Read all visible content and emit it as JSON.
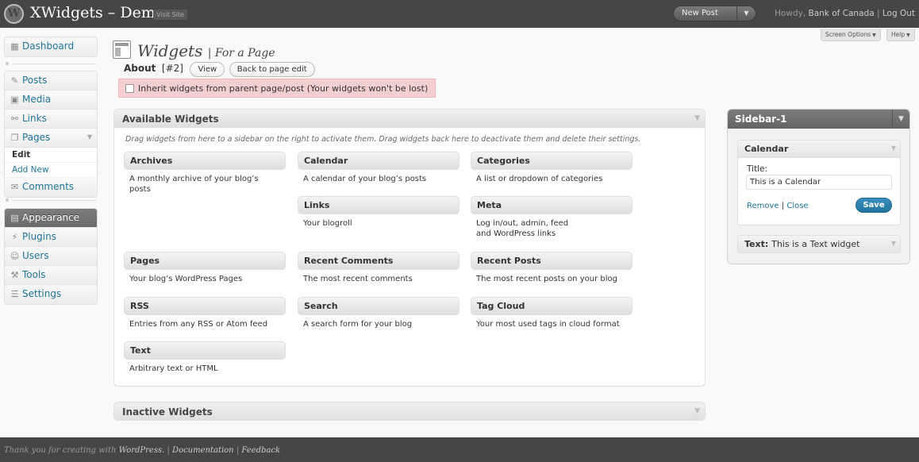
{
  "header": {
    "site_title": "XWidgets – Demo",
    "visit_site": "Visit Site",
    "favorite_action": "New Post",
    "howdy": "Howdy,",
    "user_name": "Bank of Canada",
    "separator": "|",
    "logout": "Log Out"
  },
  "screen_meta": {
    "screen_options": "Screen Options",
    "help": "Help"
  },
  "menu": {
    "dashboard": "Dashboard",
    "posts": "Posts",
    "media": "Media",
    "links": "Links",
    "pages": "Pages",
    "pages_sub": [
      "Edit",
      "Add New"
    ],
    "comments": "Comments",
    "appearance": "Appearance",
    "plugins": "Plugins",
    "users": "Users",
    "tools": "Tools",
    "settings": "Settings"
  },
  "page": {
    "title": "Widgets",
    "subtitle": "| For a Page",
    "about_label": "About",
    "about_id": "[#2]",
    "view_button": "View",
    "back_button": "Back to page edit",
    "inherit_label": "Inherit widgets from parent page/post (Your widgets won't be lost)",
    "inherit_checked": false
  },
  "available": {
    "title": "Available Widgets",
    "description": "Drag widgets from here to a sidebar on the right to activate them. Drag widgets back here to deactivate them and delete their settings.",
    "widgets": [
      {
        "title": "Archives",
        "desc": "A monthly archive of your blog’s posts"
      },
      {
        "title": "Calendar",
        "desc": "A calendar of your blog’s posts"
      },
      {
        "title": "Categories",
        "desc": "A list or dropdown of categories"
      },
      {
        "title": "Links",
        "desc": "Your blogroll"
      },
      {
        "title": "Meta",
        "desc": "Log in/out, admin, feed and WordPress links"
      },
      {
        "title": "Pages",
        "desc": "Your blog’s WordPress Pages"
      },
      {
        "title": "Recent Comments",
        "desc": "The most recent comments"
      },
      {
        "title": "Recent Posts",
        "desc": "The most recent posts on your blog"
      },
      {
        "title": "RSS",
        "desc": "Entries from any RSS or Atom feed"
      },
      {
        "title": "Search",
        "desc": "A search form for your blog"
      },
      {
        "title": "Tag Cloud",
        "desc": "Your most used tags in cloud format"
      },
      {
        "title": "Text",
        "desc": "Arbitrary text or HTML"
      }
    ]
  },
  "inactive": {
    "title": "Inactive Widgets"
  },
  "sidebar": {
    "title": "Sidebar-1",
    "calendar_widget": {
      "title": "Calendar",
      "field_label": "Title:",
      "field_value": "This is a Calendar",
      "remove": "Remove",
      "separator": "|",
      "close": "Close",
      "save": "Save"
    },
    "text_widget": {
      "type": "Text:",
      "title": "This is a Text widget"
    }
  },
  "footer": {
    "thanks": "Thank you for creating with",
    "wordpress": "WordPress.",
    "separator": "|",
    "documentation": "Documentation",
    "feedback": "Feedback"
  }
}
